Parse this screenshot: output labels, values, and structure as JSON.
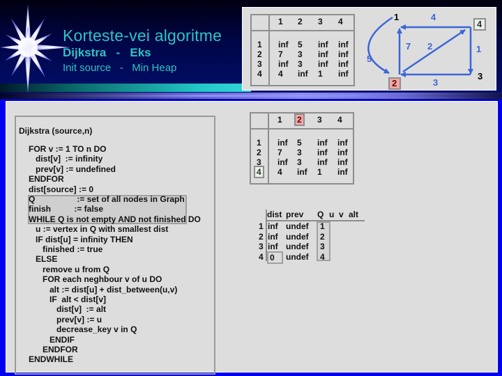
{
  "header": {
    "title": "Korteste-vei algoritme",
    "subtitle": "Dijkstra   -   Eks",
    "subtitle2": "Init source   -   Min Heap",
    "logo_icon": "star-burst-icon"
  },
  "matrix_top": {
    "column_headers": [
      "1",
      "2",
      "3",
      "4"
    ],
    "row_headers": [
      "1",
      "2",
      "3",
      "4"
    ],
    "rows": [
      [
        "inf",
        "5",
        "inf",
        "inf"
      ],
      [
        "7",
        "3",
        "inf",
        "inf"
      ],
      [
        "inf",
        "3",
        "inf",
        "inf"
      ],
      [
        "4",
        "inf",
        "1",
        "inf"
      ]
    ]
  },
  "matrix_bottom": {
    "column_headers": [
      "1",
      "2",
      "3",
      "4"
    ],
    "row_headers": [
      "1",
      "2",
      "3",
      "4"
    ],
    "highlighted_column": "2",
    "highlighted_row": "4",
    "rows": [
      [
        "inf",
        "5",
        "inf",
        "inf"
      ],
      [
        "7",
        "3",
        "inf",
        "inf"
      ],
      [
        "inf",
        "3",
        "inf",
        "inf"
      ],
      [
        "4",
        "inf",
        "1",
        "inf"
      ]
    ]
  },
  "graph": {
    "nodes": [
      {
        "id": "1",
        "highlight": "none"
      },
      {
        "id": "2",
        "highlight": "red"
      },
      {
        "id": "3",
        "highlight": "none"
      },
      {
        "id": "4",
        "highlight": "green"
      }
    ],
    "edges": [
      {
        "from": "1",
        "to": "2",
        "weight": "5"
      },
      {
        "from": "2",
        "to": "1",
        "weight": "7"
      },
      {
        "from": "4",
        "to": "1",
        "weight": "4"
      },
      {
        "from": "2",
        "to": "4",
        "weight": "2"
      },
      {
        "from": "4",
        "to": "3",
        "weight": "1"
      },
      {
        "from": "3",
        "to": "2",
        "weight": "3"
      }
    ],
    "edge_color": "#3a66d8",
    "highlight_red": "#f0a8a8",
    "highlight_green": "#e8f0e8"
  },
  "code": {
    "lines": [
      "Dijkstra (source,n)",
      "",
      "FOR v := 1 TO n DO",
      "   dist[v]  := infinity",
      "   prev[v] := undefined",
      "ENDFOR",
      "dist[source] := 0",
      "Q                  := set of all nodes in Graph",
      "finish          := false",
      "WHILE Q is not empty AND not finished DO",
      "   u := vertex in Q with smallest dist",
      "   IF dist[u] = infinity THEN",
      "      finished := true",
      "   ELSE",
      "      remove u from Q",
      "      FOR each neghbour v of u DO",
      "         alt := dist[u] + dist_between(u,v)",
      "         IF  alt < dist[v]",
      "            dist[v]  := alt",
      "            prev[v] := u",
      "            decrease_key v in Q",
      "         ENDIF",
      "      ENDFOR",
      "ENDWHILE"
    ],
    "highlighted_lines": [
      6,
      7,
      8
    ]
  },
  "state_table": {
    "headers": {
      "dist": "dist",
      "prev": "prev",
      "q": "Q",
      "u": "u",
      "v": "v",
      "alt": "alt"
    },
    "rows": [
      {
        "node": "1",
        "dist": "inf",
        "prev": "undef",
        "q": "1"
      },
      {
        "node": "2",
        "dist": "inf",
        "prev": "undef",
        "q": "2"
      },
      {
        "node": "3",
        "dist": "inf",
        "prev": "undef",
        "q": "3"
      },
      {
        "node": "4",
        "dist": "0",
        "prev": "undef",
        "q": "4"
      }
    ],
    "highlighted_dist_row": "4"
  }
}
